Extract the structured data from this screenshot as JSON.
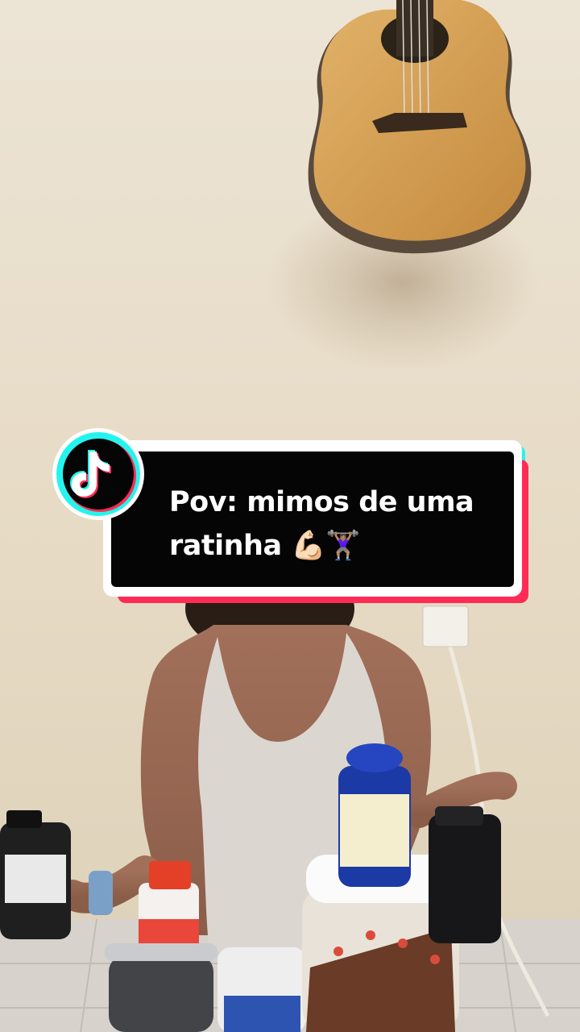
{
  "caption": {
    "text": "Pov: mimos de uma ratinha 💪🏻🏋🏽‍♀️"
  },
  "colors": {
    "accent_cyan": "#25f4ee",
    "accent_pink": "#fe2c55",
    "caption_bg": "#050505",
    "caption_text": "#ffffff",
    "wall": "#e8ddc8"
  },
  "icons": {
    "logo": "tiktok-logo-icon"
  }
}
